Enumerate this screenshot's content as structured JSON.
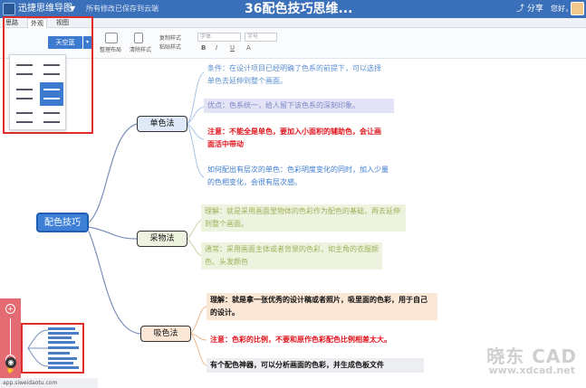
{
  "header": {
    "app_name": "迅捷思维导图",
    "caret": "▼",
    "saved_status": "所有修改已保存到云端",
    "doc_title": "36配色技巧思维...",
    "share_label": "分享",
    "hello_label": "您好，"
  },
  "tabs": [
    {
      "label": "思路"
    },
    {
      "label": "外观"
    },
    {
      "label": "视图"
    }
  ],
  "toolbar": {
    "layout_label": "整理布局",
    "clear_style_label": "清除样式",
    "copy_style_label": "复制样式",
    "paste_style_label": "粘贴样式",
    "font_placeholder": "字体",
    "size_placeholder": "字号",
    "bold": "B",
    "italic": "I",
    "underline": "U",
    "color_a": "A"
  },
  "appearance_panel": {
    "theme_button": "天空蓝",
    "dropdown": "▾"
  },
  "mindmap": {
    "root": "配色技巧",
    "branches": [
      {
        "label": "单色法"
      },
      {
        "label": "采物法"
      },
      {
        "label": "吸色法"
      }
    ],
    "notes": [
      {
        "text": "条件：在设计项目已经明确了色系的前提下，可以选择单色去延伸到整个画面。"
      },
      {
        "text": "优点：色系统一，给人留下该色系的深刻印象。"
      },
      {
        "text": "注意：不能全是单色，要加入小面积的辅助色，会让画面活中带动"
      },
      {
        "text": "如何配出有层次的单色：色彩明度变化的同时，加入少量的色相变化，会很有层次感。"
      },
      {
        "text": "理解：就是采用画面里物体的色彩作为配色的基础，再去延伸到整个画面。"
      },
      {
        "text": "通常：采用画面主体或者背景的色彩，如主角的衣服颜色、头发颜色"
      },
      {
        "text": "理解：就是拿一张优秀的设计稿或者照片，吸里面的色彩，用于自己的设计。"
      },
      {
        "text": "注意：色彩的比例，不要和原作色彩配色比例相差太大。"
      },
      {
        "text": "有个配色神器，可以分析画面的色彩，并生成色板文件"
      }
    ]
  },
  "zoom_controls": {
    "zoom_in": "+",
    "zoom_out": "−",
    "hand": "✋",
    "eye": "◉"
  },
  "status_bar": {
    "url": "app.siweidaotu.com"
  },
  "watermark": {
    "line1": "晓东 CAD",
    "line2": "www.xdcad.net"
  }
}
